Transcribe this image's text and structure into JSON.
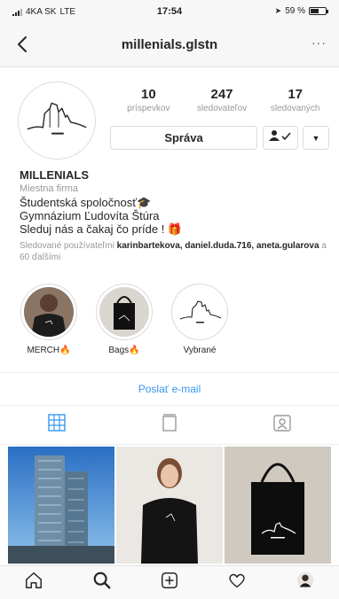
{
  "status_bar": {
    "carrier": "4KA SK",
    "network": "LTE",
    "time": "17:54",
    "battery": "59 %",
    "battery_level": 0.59
  },
  "header": {
    "username": "millenials.glstn",
    "more": "···"
  },
  "stats": [
    {
      "value": "10",
      "label": "príspevkov"
    },
    {
      "value": "247",
      "label": "sledovateľov"
    },
    {
      "value": "17",
      "label": "sledovaných"
    }
  ],
  "actions": {
    "message_label": "Správa",
    "suggest_label": "▼"
  },
  "bio": {
    "name": "MILLENIALS",
    "category": "Miestna firma",
    "lines": [
      "Študentská spoločnosť🎓",
      "Gymnázium Ľudovíta Štúra",
      "Sleduj nás a čakaj čo príde ! 🎁"
    ],
    "followed_prefix": "Sledované používateľmi ",
    "followed_users": "karinbartekova, daniel.duda.716, aneta.gularova",
    "followed_suffix": " a 60 ďalšími"
  },
  "highlights": [
    {
      "label": "MERCH🔥"
    },
    {
      "label": "Bags🔥"
    },
    {
      "label": "Vybrané"
    }
  ],
  "contact": {
    "email_label": "Poslať e-mail"
  },
  "colors": {
    "accent": "#3897f0",
    "text": "#262626",
    "muted": "#999999",
    "border": "#dbdbdb"
  }
}
